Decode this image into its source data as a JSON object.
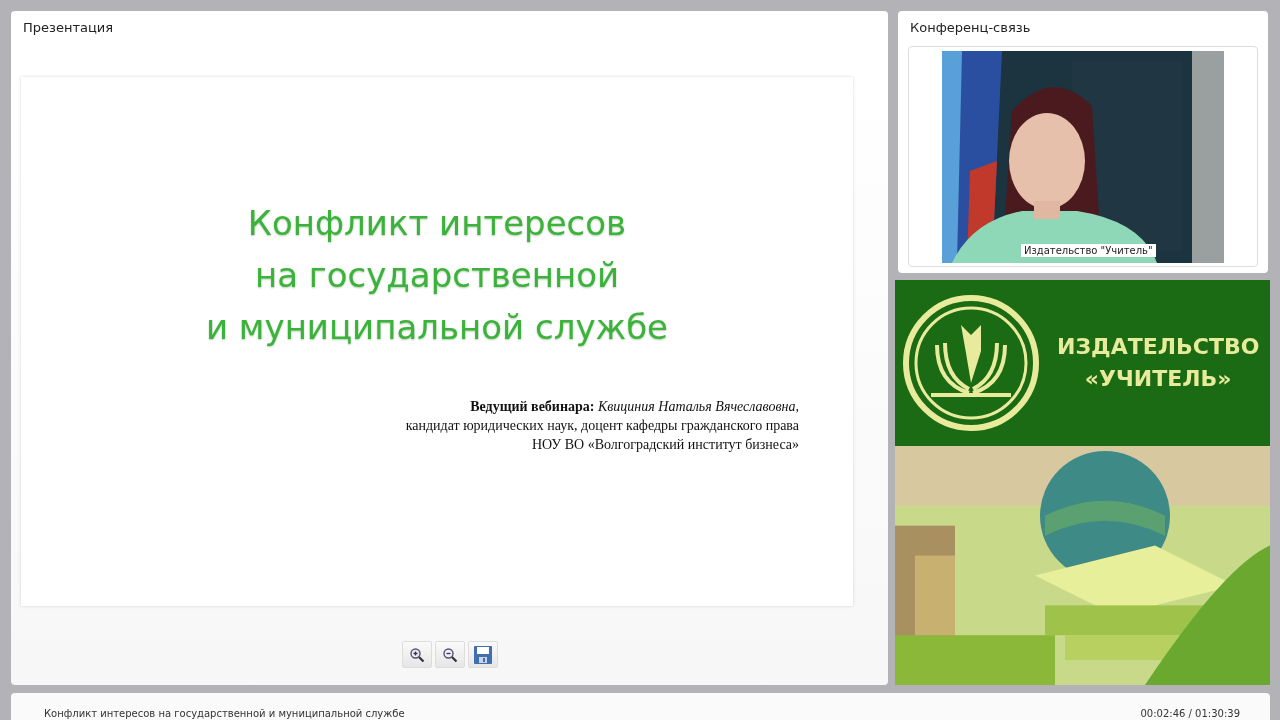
{
  "presentation": {
    "title": "Презентация",
    "slide": {
      "title_lines": [
        "Конфликт интересов",
        "на государственной",
        "и муниципальной службе"
      ],
      "presenter_label": "Ведущий вебинара:",
      "presenter_name": "Квициния Наталья Вячеславовна,",
      "presenter_info": [
        "кандидат юридических наук, доцент кафедры гражданского права",
        "НОУ ВО «Волгоградский институт бизнеса»"
      ]
    },
    "tools": [
      {
        "kind": "zoom-in"
      },
      {
        "kind": "zoom-out"
      },
      {
        "kind": "save"
      }
    ]
  },
  "conference": {
    "title": "Конференц-связь",
    "video": {
      "kind": "picture",
      "caption": "Издательство \"Учитель\""
    }
  },
  "banner": {
    "lines": [
      "ИЗДАТЕЛЬСТВО",
      "«УЧИТЕЛЬ»"
    ]
  },
  "footer": {
    "title": "Конфликт интересов на государственной и муниципальной службе",
    "time": "00:02:46 / 01:30:39"
  }
}
